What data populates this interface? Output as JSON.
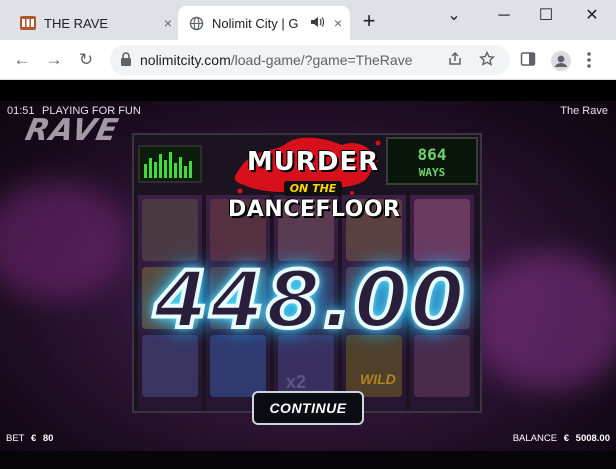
{
  "browser": {
    "tabs": [
      {
        "title": "THE RAVE",
        "close": "×"
      },
      {
        "title": "Nolimit City | G",
        "close": "×"
      }
    ],
    "new_tab": "+",
    "window": {
      "minimize": "⌄",
      "restore": "─",
      "maximize": "☐",
      "close": "✕"
    },
    "nav": {
      "back": "←",
      "forward": "→",
      "reload": "↻"
    },
    "address": {
      "host": "nolimitcity.com",
      "path": "/load-game/?game=TheRave"
    }
  },
  "game": {
    "clock": "01:51",
    "mode": "PLAYING FOR FUN",
    "name": "The Rave",
    "logo": "RAVE",
    "ways_count": "864",
    "ways_label": "WAYS",
    "feature_title": {
      "line1": "MURDER",
      "line2": "ON THE",
      "line3": "DANCEFLOOR"
    },
    "win_amount": "448.00",
    "continue_label": "CONTINUE",
    "multiplier": "x2",
    "wild": "WILD",
    "bet": {
      "label": "BET",
      "currency": "€",
      "value": "80"
    },
    "balance": {
      "label": "BALANCE",
      "currency": "€",
      "value": "5008.00"
    }
  },
  "colors": {
    "win_glow": "#33d6ff",
    "ways_text": "#6ed36e",
    "title_accent": "#ffd400",
    "splat": "#d8101c"
  }
}
